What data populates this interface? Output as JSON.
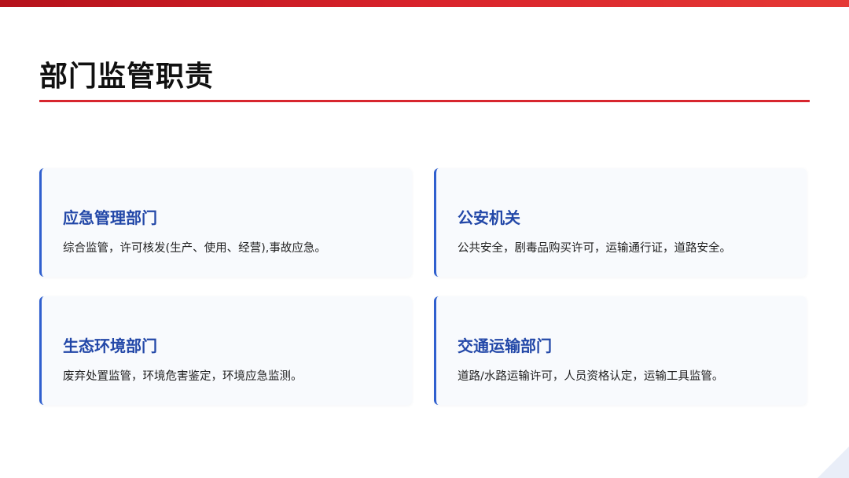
{
  "page": {
    "title": "部门监管职责"
  },
  "colors": {
    "accent_red": "#d7262e",
    "card_accent_blue": "#2f5fce",
    "card_title_blue": "#2348a8",
    "card_background": "#f8fafd"
  },
  "cards": [
    {
      "title": "应急管理部门",
      "description": "综合监管，许可核发(生产、使用、经营),事故应急。"
    },
    {
      "title": "公安机关",
      "description": "公共安全，剧毒品购买许可，运输通行证，道路安全。"
    },
    {
      "title": "生态环境部门",
      "description": "废弃处置监管，环境危害鉴定，环境应急监测。"
    },
    {
      "title": "交通运输部门",
      "description": "道路/水路运输许可，人员资格认定，运输工具监管。"
    }
  ]
}
